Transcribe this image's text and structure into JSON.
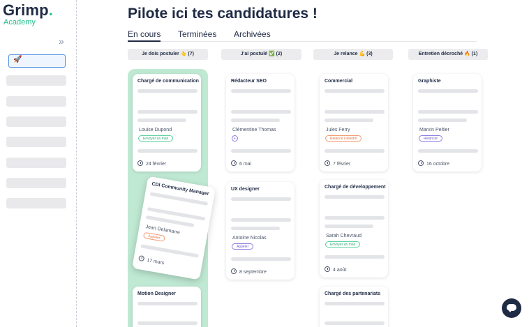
{
  "brand": {
    "name": "Grimp",
    "dot": ".",
    "sub": "Academy"
  },
  "sidebar": {
    "collapse_icon": "double-chevron-right",
    "active_icon": "rocket",
    "active_glyph": "🚀"
  },
  "page": {
    "title": "Pilote ici tes candidatures !"
  },
  "tabs": [
    {
      "label": "En cours",
      "active": true
    },
    {
      "label": "Terminées",
      "active": false
    },
    {
      "label": "Archivées",
      "active": false
    }
  ],
  "columns": [
    {
      "label": "Je dois postuler 👆 (7)"
    },
    {
      "label": "J'ai postulé ✅ (2)"
    },
    {
      "label": "Je relance 💪 (3)"
    },
    {
      "label": "Entretien décroché 🔥 (1)"
    }
  ],
  "cards": {
    "c1": {
      "title": "Chargé de communication",
      "person": "Louise Dupond",
      "tag": "Envoyer un mail",
      "date": "24 février"
    },
    "c2": {
      "title": "CDI Community Manager",
      "person": "Jean Delamarre",
      "tag": "Appeler",
      "date": "17 mars"
    },
    "c3": {
      "title": "Motion Designer"
    },
    "c4": {
      "title": "Rédacteur SEO",
      "person": "Clémentine Thomas",
      "tag": "+",
      "date": "6 mai"
    },
    "c5": {
      "title": "UX designer",
      "person": "Antoine Nicolas",
      "tag": "Appeler",
      "date": "8 septembre"
    },
    "c6": {
      "title": "Commercial",
      "person": "Jules Ferry",
      "tag": "Relance Linkedin",
      "date": "7 février"
    },
    "c7": {
      "title": "Chargé de développement",
      "person": "Sarah  Chevraud",
      "tag": "Envoyer un mail",
      "date": "4 août"
    },
    "c8": {
      "title": "Chargé des partenariats"
    },
    "c9": {
      "title": "Graphiste",
      "person": "Marvin Peltier",
      "tag": "Relancer",
      "date": "16 octobre"
    }
  },
  "colors": {
    "accent_green": "#22c08a",
    "column_highlight": "#bfe9d3",
    "navy": "#1f2a44"
  }
}
